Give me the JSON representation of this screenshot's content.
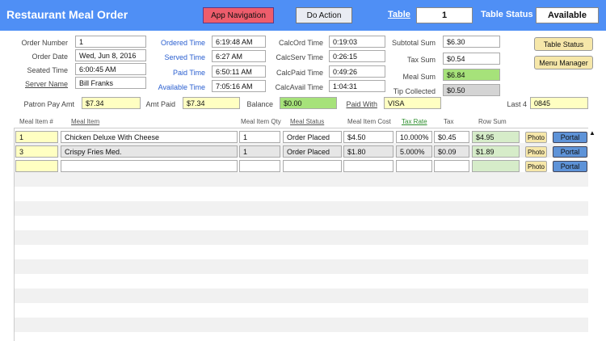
{
  "header": {
    "title": "Restaurant Meal Order",
    "nav_button": "App Navigation",
    "action_button": "Do Action",
    "table_label": "Table",
    "table_value": "1",
    "status_label": "Table Status",
    "status_value": "Available"
  },
  "order": {
    "number_label": "Order Number",
    "number": "1",
    "date_label": "Order Date",
    "date": "Wed, Jun 8, 2016",
    "seated_label": "Seated Time",
    "seated": "6:00:45 AM",
    "server_label": "Server Name",
    "server": "Bill Franks"
  },
  "times": {
    "ordered_label": "Ordered Time",
    "ordered": "6:19:48 AM",
    "served_label": "Served Time",
    "served": "6:27 AM",
    "paid_label": "Paid Time",
    "paid": "6:50:11 AM",
    "available_label": "Available Time",
    "available": "7:05:16 AM"
  },
  "calc": {
    "ord_label": "CalcOrd Time",
    "ord": "0:19:03",
    "serv_label": "CalcServ Time",
    "serv": "0:26:15",
    "paid_label": "CalcPaid Time",
    "paid": "0:49:26",
    "avail_label": "CalcAvail Time",
    "avail": "1:04:31"
  },
  "sums": {
    "subtotal_label": "Subtotal Sum",
    "subtotal": "$6.30",
    "tax_label": "Tax Sum",
    "tax": "$0.54",
    "meal_label": "Meal Sum",
    "meal": "$6.84",
    "tip_label": "Tip Collected",
    "tip": "$0.50"
  },
  "side_buttons": {
    "table_status": "Table Status",
    "menu_manager": "Menu Manager"
  },
  "payment": {
    "patron_label": "Patron Pay Amt",
    "patron": "$7.34",
    "amt_paid_label": "Amt Paid",
    "amt_paid": "$7.34",
    "balance_label": "Balance",
    "balance": "$0.00",
    "paid_with_label": "Paid With",
    "paid_with": "VISA",
    "last4_label": "Last 4",
    "last4": "0845"
  },
  "table": {
    "headers": {
      "item_no": "Meal Item #",
      "item": "Meal Item",
      "qty": "Meal Item Qty",
      "status": "Meal Status",
      "cost": "Meal Item Cost",
      "tax_rate": "Tax Rate",
      "tax": "Tax",
      "row_sum": "Row Sum"
    },
    "photo_label": "Photo",
    "portal_label": "Portal",
    "rows": [
      {
        "item_no": "1",
        "item": "Chicken Deluxe With Cheese",
        "qty": "1",
        "status": "Order Placed",
        "cost": "$4.50",
        "tax_rate": "10.000%",
        "tax": "$0.45",
        "row_sum": "$4.95"
      },
      {
        "item_no": "3",
        "item": "Crispy Fries Med.",
        "qty": "1",
        "status": "Order Placed",
        "cost": "$1.80",
        "tax_rate": "5.000%",
        "tax": "$0.09",
        "row_sum": "$1.89"
      },
      {
        "item_no": "",
        "item": "",
        "qty": "",
        "status": "",
        "cost": "",
        "tax_rate": "",
        "tax": "",
        "row_sum": ""
      }
    ]
  },
  "scroll_up_glyph": "▲",
  "colors": {
    "header_bg": "#4f8ff5",
    "nav_button": "#ee5d6c",
    "meal_sum_green": "#a6e27a",
    "yellow_field": "#ffffc2",
    "portal_blue": "#5e93d8"
  }
}
